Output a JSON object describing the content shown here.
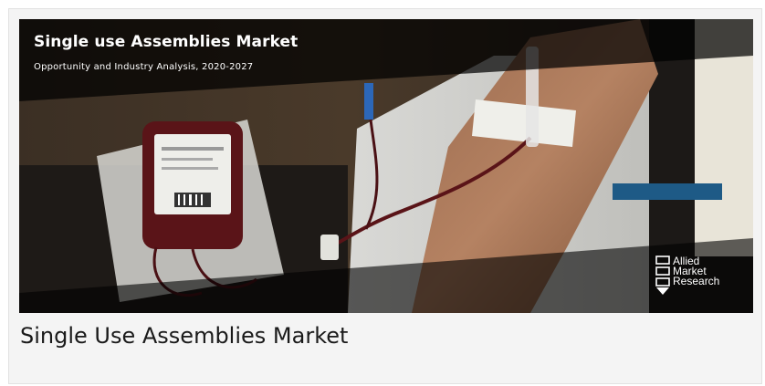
{
  "banner": {
    "title": "Single use Assemblies Market",
    "subtitle": "Opportunity and Industry Analysis, 2020-2027",
    "photo_icon": "blood-donation-photo"
  },
  "logo": {
    "icon": "allied-market-research-logo",
    "line1": "Allied",
    "line2": "Market",
    "line3": "Research"
  },
  "caption": {
    "text": "Single Use Assemblies Market"
  },
  "colors": {
    "card_bg": "#f4f4f4",
    "blood": "#5a1418",
    "banner_overlay": "#000000"
  }
}
